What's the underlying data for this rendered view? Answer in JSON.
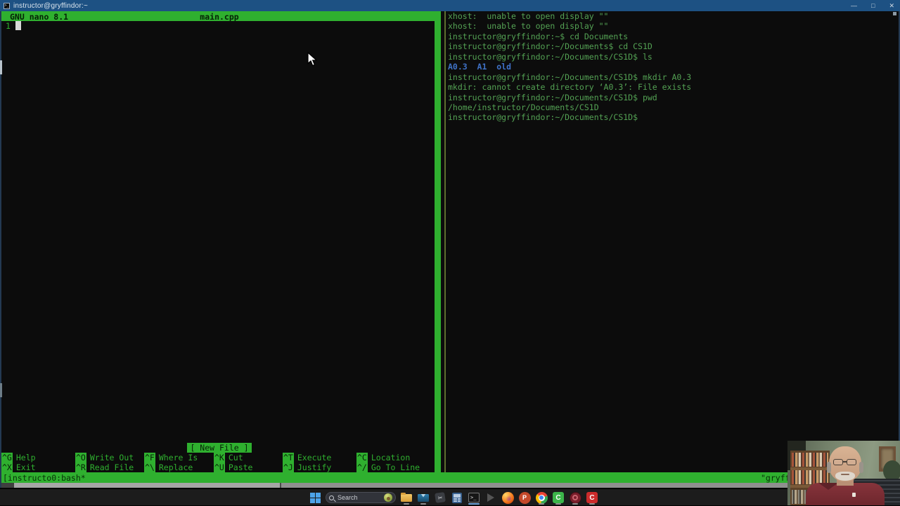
{
  "window": {
    "title": "instructor@gryffindor:~",
    "controls": {
      "minimize": "—",
      "maximize": "□",
      "close": "✕"
    }
  },
  "nano": {
    "version_label": "GNU nano 8.1",
    "filename": "main.cpp",
    "line_number": "1",
    "status": "[ New File ]",
    "shortcuts": [
      {
        "key": "^G",
        "label": "Help"
      },
      {
        "key": "^O",
        "label": "Write Out"
      },
      {
        "key": "^F",
        "label": "Where Is"
      },
      {
        "key": "^K",
        "label": "Cut"
      },
      {
        "key": "^T",
        "label": "Execute"
      },
      {
        "key": "^C",
        "label": "Location"
      },
      {
        "key": "^X",
        "label": "Exit"
      },
      {
        "key": "^R",
        "label": "Read File"
      },
      {
        "key": "^\\",
        "label": "Replace"
      },
      {
        "key": "^U",
        "label": "Paste"
      },
      {
        "key": "^J",
        "label": "Justify"
      },
      {
        "key": "^/",
        "label": "Go To Line"
      }
    ]
  },
  "terminal": {
    "lines": [
      {
        "text": "xhost:  unable to open display \"\"",
        "color": "green"
      },
      {
        "text": "xhost:  unable to open display \"\"",
        "color": "green"
      },
      {
        "text": "instructor@gryffindor:~$ cd Documents",
        "color": "green"
      },
      {
        "text": "instructor@gryffindor:~/Documents$ cd CS1D",
        "color": "green"
      },
      {
        "text": "instructor@gryffindor:~/Documents/CS1D$ ls",
        "color": "green"
      },
      {
        "text": "A0.3  A1  old",
        "color": "blue"
      },
      {
        "text": "instructor@gryffindor:~/Documents/CS1D$ mkdir A0.3",
        "color": "green"
      },
      {
        "text": "mkdir: cannot create directory ‘A0.3’: File exists",
        "color": "green"
      },
      {
        "text": "instructor@gryffindor:~/Documents/CS1D$ pwd",
        "color": "green"
      },
      {
        "text": "/home/instructor/Documents/CS1D",
        "color": "green"
      },
      {
        "text": "instructor@gryffindor:~/Documents/CS1D$",
        "color": "green"
      }
    ]
  },
  "tmux": {
    "left_status": "[instructo0:bash*",
    "right_status": "\"gryffindor\""
  },
  "taskbar": {
    "search_label": "Search",
    "terminal_glyph": ">_",
    "snip_glyph": "✂",
    "icon_glyphs": {
      "powerpoint": "P",
      "camtasia": "C",
      "capture": "C"
    },
    "icons": [
      "start",
      "search",
      "file-explorer",
      "mail",
      "snipping-tool",
      "calculator",
      "terminal",
      "faded-arrow",
      "firefox",
      "powerpoint",
      "chrome",
      "camtasia",
      "maroon-circle-app",
      "capture"
    ]
  },
  "colors": {
    "green_accent": "#2fb02f",
    "terminal_text_green": "#54a254",
    "directory_blue": "#3f72c8",
    "titlebar_blue": "#1d5183",
    "terminal_background": "#0c0c0c",
    "taskbar_background": "#1c1c1c",
    "shirt_maroon": "#7c2f36"
  }
}
